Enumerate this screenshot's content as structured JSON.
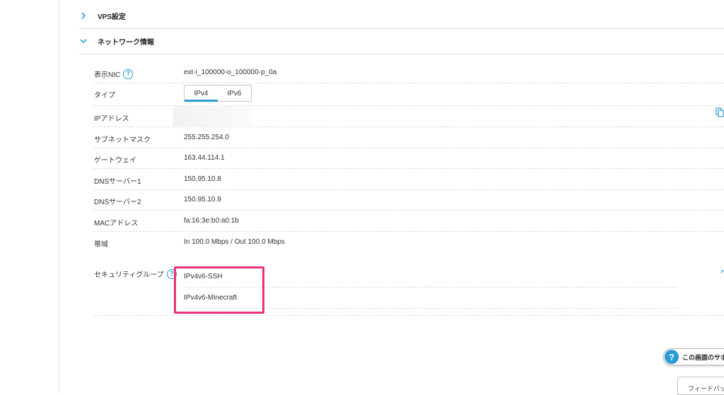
{
  "sections": {
    "vps_settings": {
      "title": "VPS設定",
      "expanded": false
    },
    "network_info": {
      "title": "ネットワーク情報",
      "expanded": true
    }
  },
  "network": {
    "nic": {
      "label": "表示NIC",
      "value": "ext-i_100000-o_100000-p_0a"
    },
    "type": {
      "label": "タイプ",
      "tabs": [
        "IPv4",
        "IPv6"
      ],
      "active_tab": "IPv4"
    },
    "ip_address": {
      "label": "IPアドレス",
      "value": ""
    },
    "subnet_mask": {
      "label": "サブネットマスク",
      "value": "255.255.254.0"
    },
    "gateway": {
      "label": "ゲートウェイ",
      "value": "163.44.114.1"
    },
    "dns1": {
      "label": "DNSサーバー1",
      "value": "150.95.10.8"
    },
    "dns2": {
      "label": "DNSサーバー2",
      "value": "150.95.10.9"
    },
    "mac": {
      "label": "MACアドレス",
      "value": "fa:16:3e:b0:a0:1b"
    },
    "bandwidth": {
      "label": "帯域",
      "value": "In 100.0 Mbps / Out 100.0 Mbps"
    }
  },
  "security_groups": {
    "label": "セキュリティグループ",
    "items": [
      "IPv4v6-SSH",
      "IPv4v6-Minecraft"
    ]
  },
  "support": {
    "label": "この画面のサポー",
    "icon": "question-icon"
  },
  "feedback": {
    "label": "フィードバッ"
  },
  "colors": {
    "accent": "#2b9bd6",
    "highlight": "#e8327a"
  }
}
